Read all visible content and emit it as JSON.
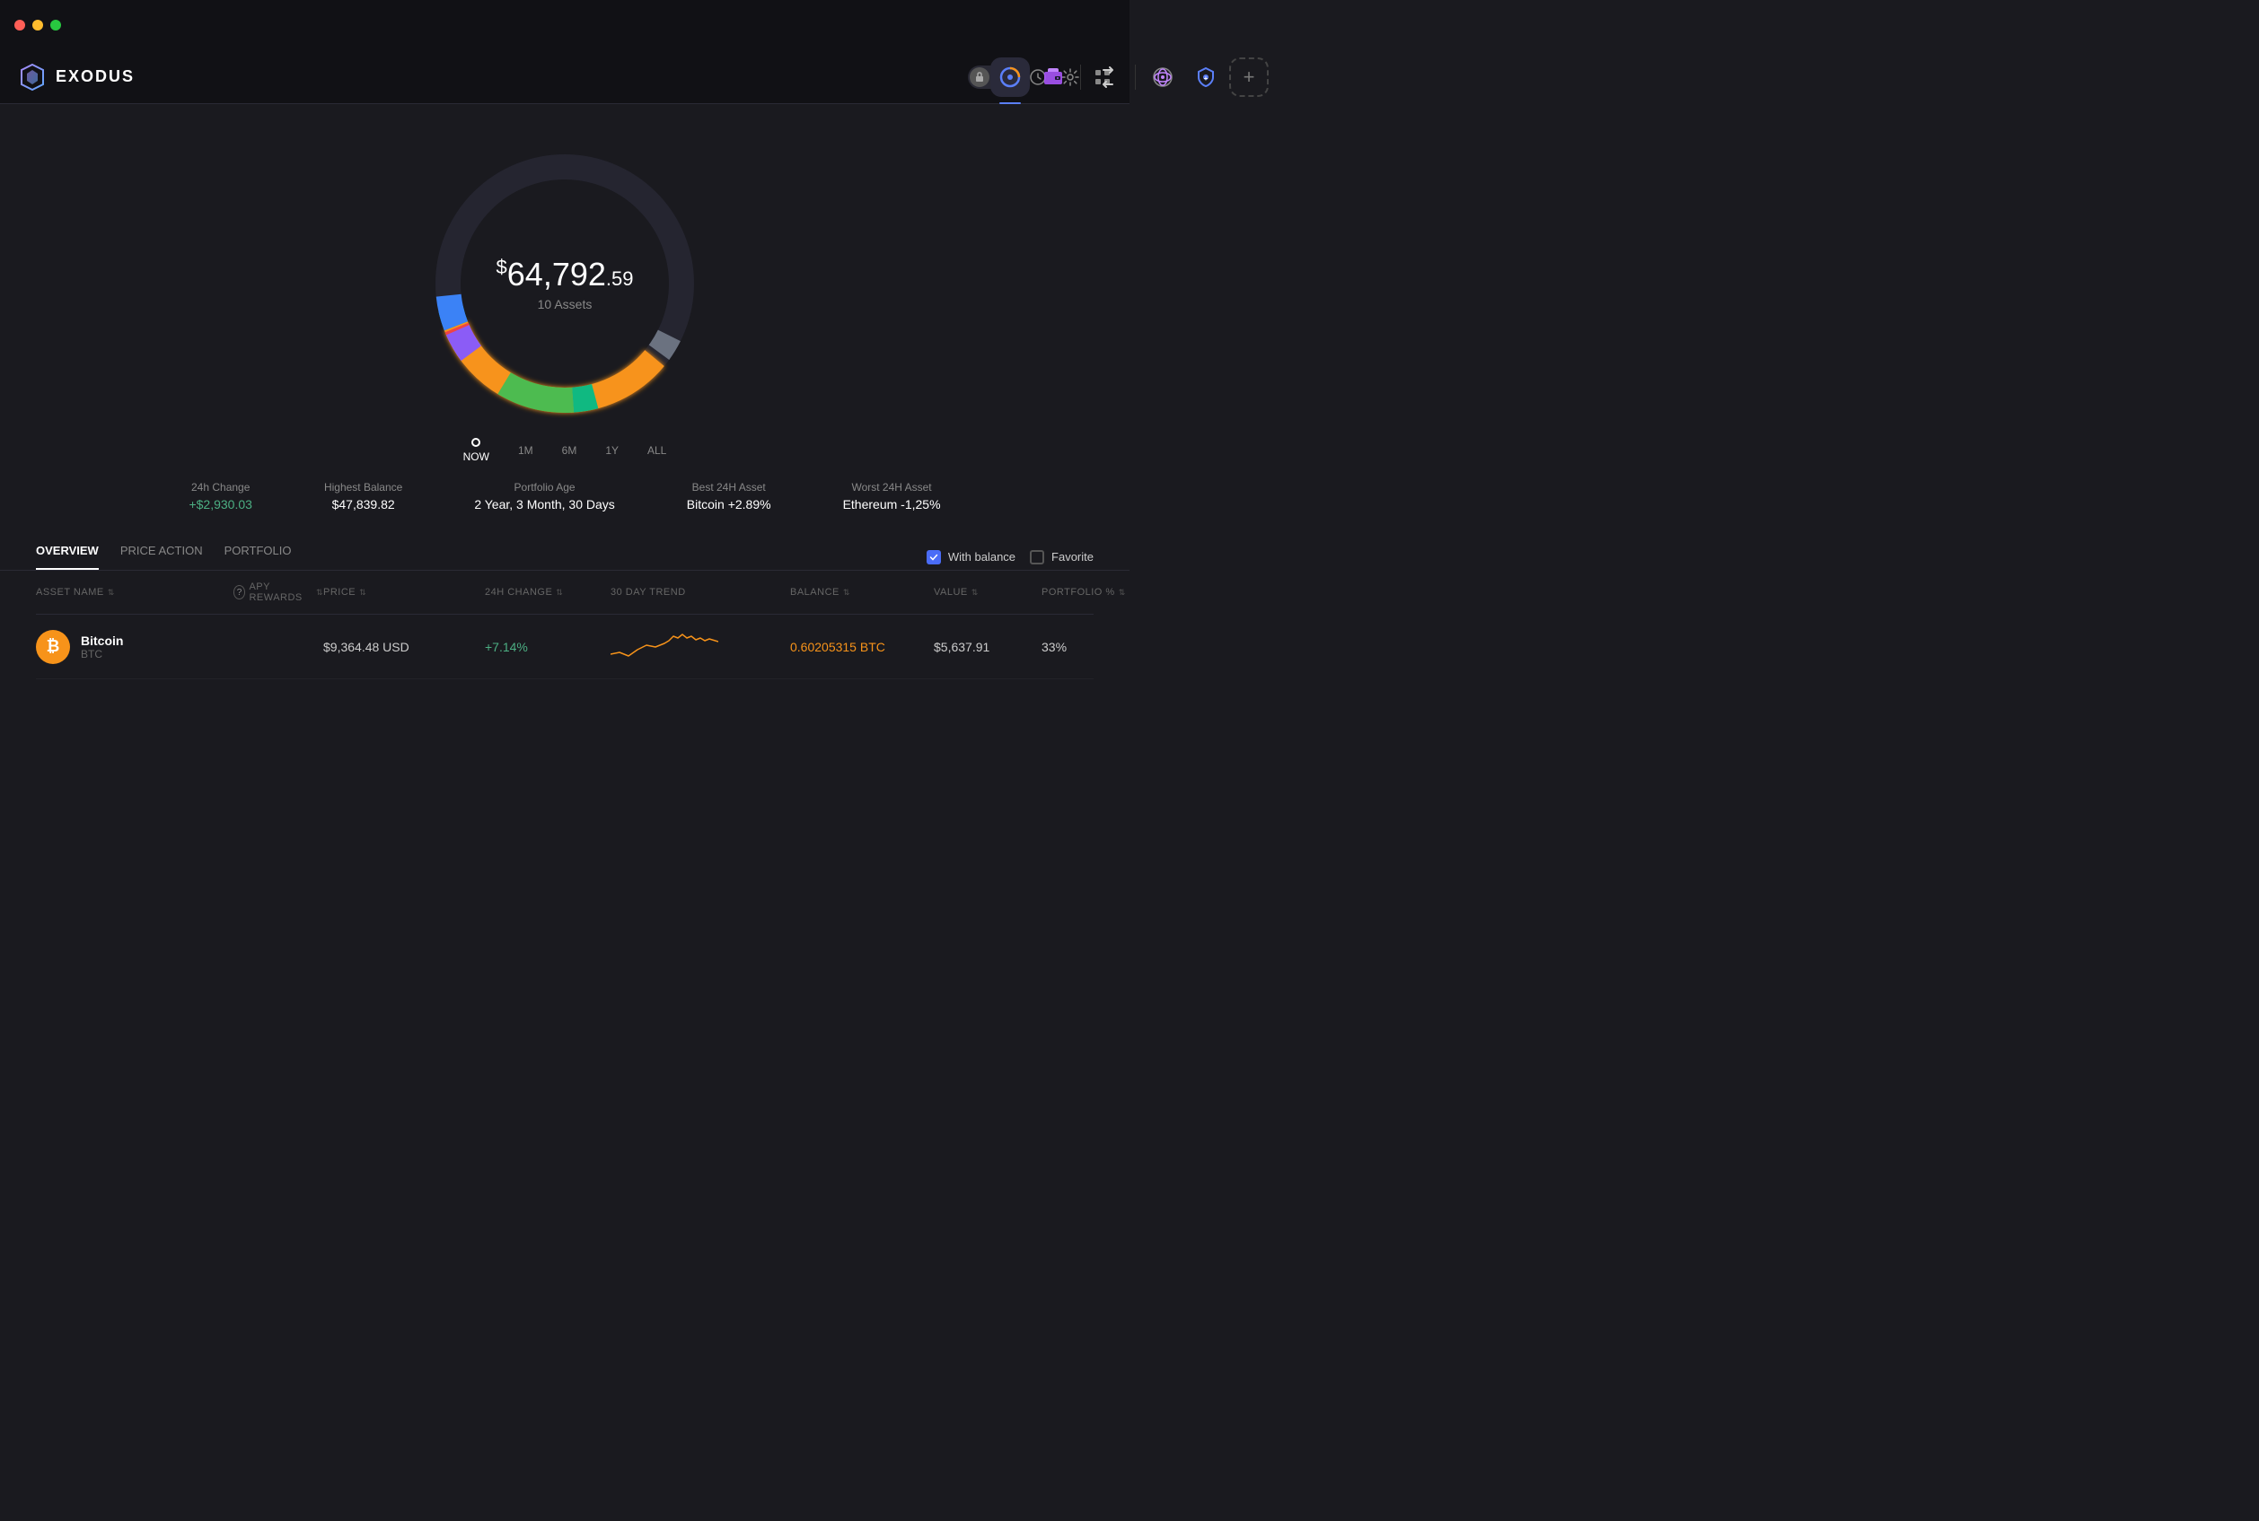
{
  "titlebar": {
    "trafficLights": [
      "red",
      "yellow",
      "green"
    ]
  },
  "logo": {
    "text": "EXODUS"
  },
  "nav": {
    "center_icons": [
      {
        "name": "portfolio-icon",
        "label": "Portfolio",
        "active": true
      },
      {
        "name": "wallet-icon",
        "label": "Wallet",
        "active": false
      },
      {
        "name": "exchange-icon",
        "label": "Exchange",
        "active": false
      },
      {
        "name": "nft-icon",
        "label": "NFT",
        "active": false
      },
      {
        "name": "earn-icon",
        "label": "Earn",
        "active": false
      }
    ],
    "add_label": "+",
    "right": {
      "lock_label": "lock",
      "history_label": "history",
      "settings_label": "settings",
      "grid_label": "grid"
    }
  },
  "portfolio": {
    "amount_dollar": "$",
    "amount_main": "64,792",
    "amount_cents": ".59",
    "assets_label": "10 Assets"
  },
  "timeline": {
    "items": [
      {
        "label": "NOW",
        "active": true
      },
      {
        "label": "1M",
        "active": false
      },
      {
        "label": "6M",
        "active": false
      },
      {
        "label": "1Y",
        "active": false
      },
      {
        "label": "ALL",
        "active": false
      }
    ]
  },
  "stats": [
    {
      "label": "24h Change",
      "value": "+$2,930.03",
      "positive": true
    },
    {
      "label": "Highest Balance",
      "value": "$47,839.82",
      "positive": false
    },
    {
      "label": "Portfolio Age",
      "value": "2 Year, 3 Month, 30 Days",
      "positive": false
    },
    {
      "label": "Best 24H Asset",
      "value": "Bitcoin +2.89%",
      "positive": false
    },
    {
      "label": "Worst 24H Asset",
      "value": "Ethereum -1,25%",
      "positive": false
    }
  ],
  "tabs": {
    "items": [
      {
        "label": "OVERVIEW",
        "active": true
      },
      {
        "label": "PRICE ACTION",
        "active": false
      },
      {
        "label": "PORTFOLIO",
        "active": false
      }
    ],
    "filter": {
      "with_balance_label": "With balance",
      "with_balance_checked": true,
      "favorite_label": "Favorite",
      "favorite_checked": false
    }
  },
  "table": {
    "headers": [
      {
        "label": "ASSET NAME",
        "sortable": true
      },
      {
        "label": "APY REWARDS",
        "sortable": true,
        "has_question": true
      },
      {
        "label": "PRICE",
        "sortable": true
      },
      {
        "label": "24H CHANGE",
        "sortable": true
      },
      {
        "label": "30 DAY TREND",
        "sortable": false
      },
      {
        "label": "BALANCE",
        "sortable": true
      },
      {
        "label": "VALUE",
        "sortable": true
      },
      {
        "label": "PORTFOLIO %",
        "sortable": true
      }
    ],
    "rows": [
      {
        "icon": "₿",
        "icon_bg": "#f7931a",
        "name": "Bitcoin",
        "ticker": "BTC",
        "apy": "",
        "price": "$9,364.48 USD",
        "change": "+7.14%",
        "change_positive": true,
        "balance": "0.60205315 BTC",
        "balance_highlighted": true,
        "value": "$5,637.91",
        "portfolio_pct": "33%"
      }
    ]
  }
}
